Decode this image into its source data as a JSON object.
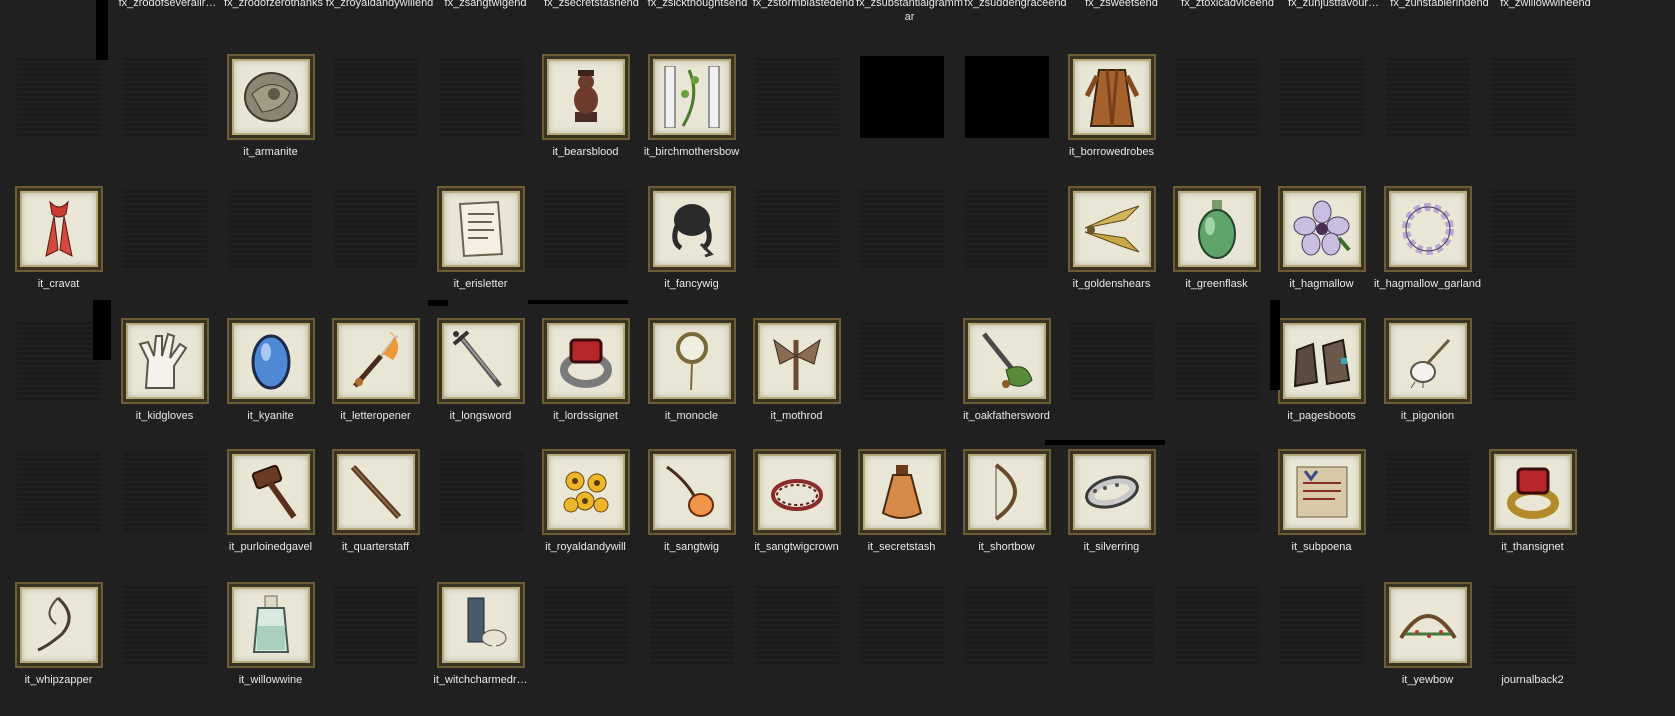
{
  "fx_row": [
    {
      "label": "fx_zrodofseveralir…"
    },
    {
      "label": "fx_zrodofzerothanks"
    },
    {
      "label": "fx_zroyaldandywillend"
    },
    {
      "label": "fx_zsangtwigend"
    },
    {
      "label": "fx_zsecretstashend"
    },
    {
      "label": "fx_zsickthoughtsend"
    },
    {
      "label": "fx_zstormblastedend"
    },
    {
      "label": "fx_zsubstantialgrammar"
    },
    {
      "label": "fx_zsuddengraceend"
    },
    {
      "label": "fx_zsweetsend"
    },
    {
      "label": "fx_ztoxicadviceend"
    },
    {
      "label": "fx_zunjustfavour…"
    },
    {
      "label": "fx_zunstablerindend"
    },
    {
      "label": "fx_zwillowwineend"
    }
  ],
  "rows": [
    [
      {
        "type": "dark"
      },
      {
        "type": "dark"
      },
      {
        "type": "item",
        "icon": "armanite-icon",
        "label": "it_armanite"
      },
      {
        "type": "dark"
      },
      {
        "type": "dark"
      },
      {
        "type": "item",
        "icon": "bear-statue-icon",
        "label": "it_bearsblood"
      },
      {
        "type": "item",
        "icon": "birch-bow-icon",
        "label": "it_birchmothersbow"
      },
      {
        "type": "dark"
      },
      {
        "type": "black"
      },
      {
        "type": "black"
      },
      {
        "type": "item",
        "icon": "robes-icon",
        "label": "it_borrowedrobes"
      },
      {
        "type": "dark"
      },
      {
        "type": "dark"
      },
      {
        "type": "dark"
      },
      {
        "type": "dark"
      }
    ],
    [
      {
        "type": "item",
        "icon": "cravat-icon",
        "label": "it_cravat"
      },
      {
        "type": "dark"
      },
      {
        "type": "dark"
      },
      {
        "type": "dark"
      },
      {
        "type": "item",
        "icon": "letter-icon",
        "label": "it_erisletter"
      },
      {
        "type": "dark"
      },
      {
        "type": "item",
        "icon": "wig-icon",
        "label": "it_fancywig"
      },
      {
        "type": "dark"
      },
      {
        "type": "dark"
      },
      {
        "type": "dark"
      },
      {
        "type": "item",
        "icon": "shears-icon",
        "label": "it_goldenshears"
      },
      {
        "type": "item",
        "icon": "flask-icon",
        "label": "it_greenflask"
      },
      {
        "type": "item",
        "icon": "flower-icon",
        "label": "it_hagmallow"
      },
      {
        "type": "item",
        "icon": "garland-icon",
        "label": "it_hagmallow_garland"
      },
      {
        "type": "dark"
      }
    ],
    [
      {
        "type": "dark"
      },
      {
        "type": "item",
        "icon": "gloves-icon",
        "label": "it_kidgloves"
      },
      {
        "type": "item",
        "icon": "gem-icon",
        "label": "it_kyanite"
      },
      {
        "type": "item",
        "icon": "letter-opener-icon",
        "label": "it_letteropener"
      },
      {
        "type": "item",
        "icon": "longsword-icon",
        "label": "it_longsword"
      },
      {
        "type": "item",
        "icon": "signet-ring-icon",
        "label": "it_lordssignet"
      },
      {
        "type": "item",
        "icon": "monocle-icon",
        "label": "it_monocle"
      },
      {
        "type": "item",
        "icon": "moth-rod-icon",
        "label": "it_mothrod"
      },
      {
        "type": "dark"
      },
      {
        "type": "item",
        "icon": "oak-sword-icon",
        "label": "it_oakfathersword"
      },
      {
        "type": "dark"
      },
      {
        "type": "dark"
      },
      {
        "type": "item",
        "icon": "boots-icon",
        "label": "it_pagesboots"
      },
      {
        "type": "item",
        "icon": "onion-icon",
        "label": "it_pigonion"
      },
      {
        "type": "dark"
      }
    ],
    [
      {
        "type": "dark"
      },
      {
        "type": "dark"
      },
      {
        "type": "item",
        "icon": "gavel-icon",
        "label": "it_purloinedgavel"
      },
      {
        "type": "item",
        "icon": "staff-icon",
        "label": "it_quarterstaff"
      },
      {
        "type": "dark"
      },
      {
        "type": "item",
        "icon": "yellow-flowers-icon",
        "label": "it_royaldandywill"
      },
      {
        "type": "item",
        "icon": "twig-fruit-icon",
        "label": "it_sangtwig"
      },
      {
        "type": "item",
        "icon": "thorn-crown-icon",
        "label": "it_sangtwigcrown"
      },
      {
        "type": "item",
        "icon": "bottle-icon",
        "label": "it_secretstash"
      },
      {
        "type": "item",
        "icon": "bow-icon",
        "label": "it_shortbow"
      },
      {
        "type": "item",
        "icon": "silver-ring-icon",
        "label": "it_silverring"
      },
      {
        "type": "dark"
      },
      {
        "type": "item",
        "icon": "subpoena-icon",
        "label": "it_subpoena"
      },
      {
        "type": "dark"
      },
      {
        "type": "item",
        "icon": "thane-ring-icon",
        "label": "it_thansignet"
      }
    ],
    [
      {
        "type": "item",
        "icon": "whip-icon",
        "label": "it_whipzapper"
      },
      {
        "type": "dark"
      },
      {
        "type": "item",
        "icon": "wine-bottle-icon",
        "label": "it_willowwine"
      },
      {
        "type": "dark"
      },
      {
        "type": "item",
        "icon": "charm-icon",
        "label": "it_witchcharmedr…"
      },
      {
        "type": "dark"
      },
      {
        "type": "dark"
      },
      {
        "type": "dark"
      },
      {
        "type": "dark"
      },
      {
        "type": "dark"
      },
      {
        "type": "dark"
      },
      {
        "type": "dark"
      },
      {
        "type": "dark"
      },
      {
        "type": "item",
        "icon": "yew-bow-icon",
        "label": "it_yewbow"
      },
      {
        "type": "dark",
        "label": "journalback2"
      }
    ]
  ],
  "colors": {
    "background": "#202020",
    "tile_paper": "#e9e6d6",
    "tile_frame": "#3a3222",
    "text": "#e8e8e8"
  }
}
